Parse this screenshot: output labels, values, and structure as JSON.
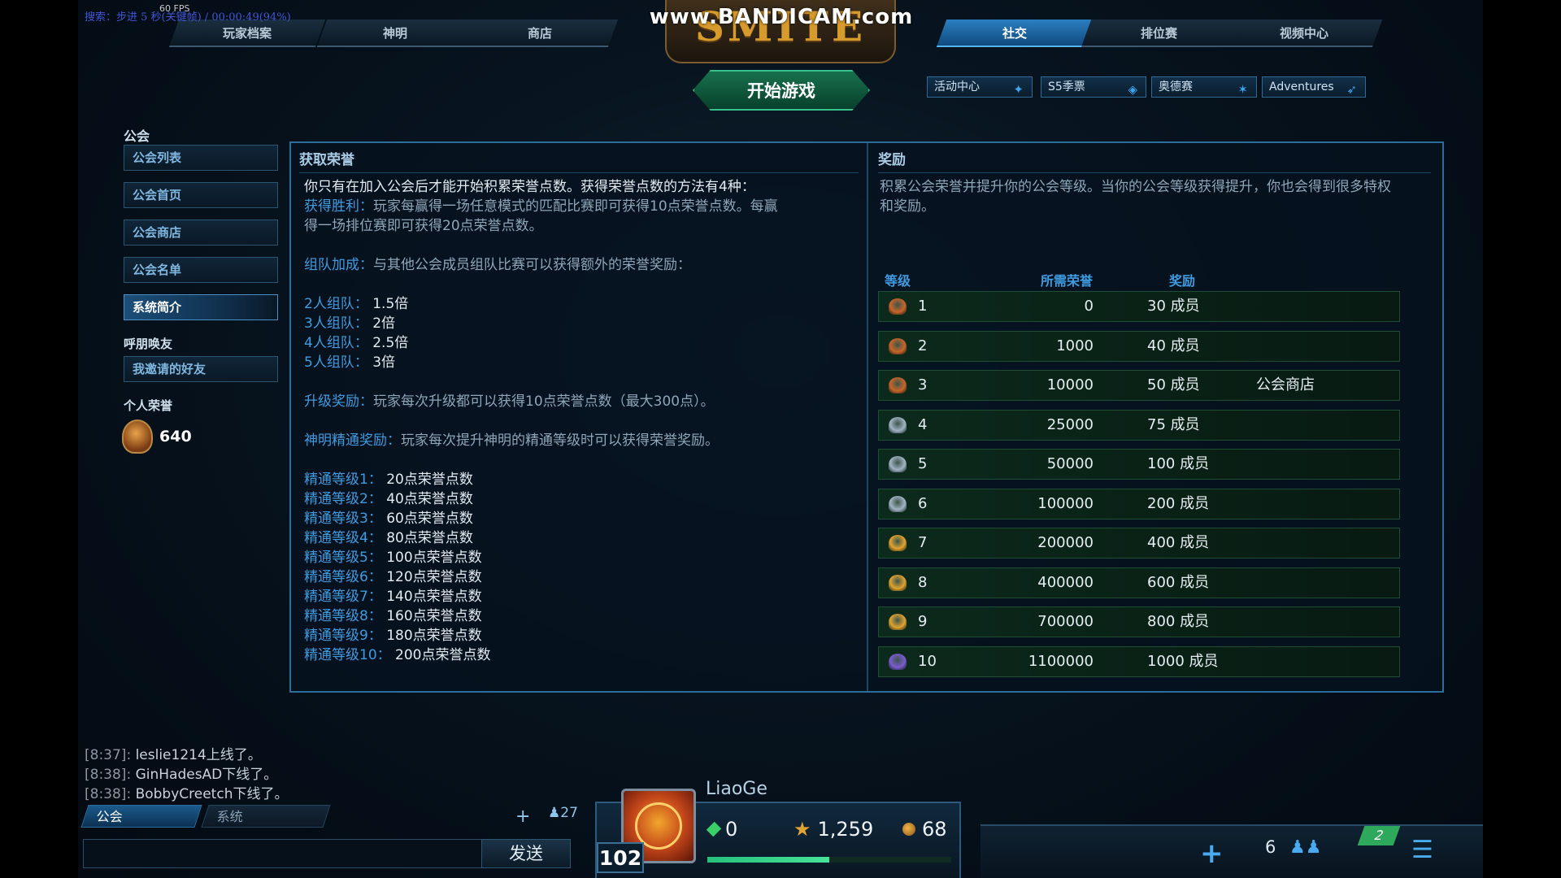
{
  "recorder": {
    "status_text": "搜索：步进 5 秒(关键帧) / 00:00:49(94%)",
    "fps_text": "60 FPS",
    "watermark": "www.BANDICAM.com"
  },
  "window": {
    "close_label": "✕"
  },
  "logo_text": "SMITE",
  "top_tabs": [
    {
      "label": "玩家档案"
    },
    {
      "label": "神明"
    },
    {
      "label": "商店"
    },
    {
      "label": "社交"
    },
    {
      "label": "排位赛"
    },
    {
      "label": "视频中心"
    }
  ],
  "active_top_tab": "社交",
  "play_button": "开始游戏",
  "sub_tabs": [
    {
      "label": "活动中心",
      "icon": "event-icon"
    },
    {
      "label": "S5季票",
      "icon": "season-pass-icon"
    },
    {
      "label": "奥德赛",
      "icon": "odyssey-icon"
    },
    {
      "label": "Adventures",
      "icon": "adventure-icon"
    }
  ],
  "sidebar": {
    "guild_heading": "公会",
    "guild_items": [
      {
        "label": "公会列表"
      },
      {
        "label": "公会首页"
      },
      {
        "label": "公会商店"
      },
      {
        "label": "公会名单"
      },
      {
        "label": "系统简介"
      }
    ],
    "active_item": "系统简介",
    "friends_heading": "呼朋唤友",
    "friends_items": [
      {
        "label": "我邀请的好友"
      }
    ],
    "honor_heading": "个人荣誉",
    "honor_value": "640"
  },
  "earn_section": {
    "title": "获取荣誉",
    "intro": "你只有在加入公会后才能开始积累荣誉点数。获得荣誉点数的方法有4种：",
    "win_label": "获得胜利：",
    "win_text_1": "玩家每赢得一场任意模式的匹配比赛即可获得10点荣誉点数。每赢",
    "win_text_2": "得一场排位赛即可获得20点荣誉点数。",
    "party_label": "组队加成：",
    "party_text": "与其他公会成员组队比赛可以获得额外的荣誉奖励：",
    "party_bonuses": [
      {
        "label": "2人组队：",
        "value": "1.5倍"
      },
      {
        "label": "3人组队：",
        "value": "2倍"
      },
      {
        "label": "4人组队：",
        "value": "2.5倍"
      },
      {
        "label": "5人组队：",
        "value": "3倍"
      }
    ],
    "levelup_label": "升级奖励：",
    "levelup_text": "玩家每次升级都可以获得10点荣誉点数（最大300点）。",
    "mastery_label": "神明精通奖励：",
    "mastery_text": "玩家每次提升神明的精通等级时可以获得荣誉奖励。",
    "mastery_levels": [
      {
        "label": "精通等级1：",
        "value": "20点荣誉点数"
      },
      {
        "label": "精通等级2：",
        "value": "40点荣誉点数"
      },
      {
        "label": "精通等级3：",
        "value": "60点荣誉点数"
      },
      {
        "label": "精通等级4：",
        "value": "80点荣誉点数"
      },
      {
        "label": "精通等级5：",
        "value": "100点荣誉点数"
      },
      {
        "label": "精通等级6：",
        "value": "120点荣誉点数"
      },
      {
        "label": "精通等级7：",
        "value": "140点荣誉点数"
      },
      {
        "label": "精通等级8：",
        "value": "160点荣誉点数"
      },
      {
        "label": "精通等级9：",
        "value": "180点荣誉点数"
      },
      {
        "label": "精通等级10：",
        "value": "200点荣誉点数"
      }
    ]
  },
  "reward_section": {
    "title": "奖励",
    "intro": "积累公会荣誉并提升你的公会等级。当你的公会等级获得提升，你也会得到很多特权和奖励。",
    "headers": {
      "level": "等级",
      "required": "所需荣誉",
      "reward": "奖励"
    },
    "rows": [
      {
        "level": "1",
        "required": "0",
        "reward": "30 成员",
        "extra": "",
        "icon_color": "#c9652a"
      },
      {
        "level": "2",
        "required": "1000",
        "reward": "40 成员",
        "extra": "",
        "icon_color": "#c9652a"
      },
      {
        "level": "3",
        "required": "10000",
        "reward": "50 成员",
        "extra": "公会商店",
        "icon_color": "#c9652a"
      },
      {
        "level": "4",
        "required": "25000",
        "reward": "75 成员",
        "extra": "",
        "icon_color": "#9fb3c4"
      },
      {
        "level": "5",
        "required": "50000",
        "reward": "100 成员",
        "extra": "",
        "icon_color": "#9fb3c4"
      },
      {
        "level": "6",
        "required": "100000",
        "reward": "200 成员",
        "extra": "",
        "icon_color": "#9fb3c4"
      },
      {
        "level": "7",
        "required": "200000",
        "reward": "400 成员",
        "extra": "",
        "icon_color": "#e0a22e"
      },
      {
        "level": "8",
        "required": "400000",
        "reward": "600 成员",
        "extra": "",
        "icon_color": "#e0a22e"
      },
      {
        "level": "9",
        "required": "700000",
        "reward": "800 成员",
        "extra": "",
        "icon_color": "#e0a22e"
      },
      {
        "level": "10",
        "required": "1100000",
        "reward": "1000 成员",
        "extra": "",
        "icon_color": "#7a5bd0"
      }
    ]
  },
  "chat": {
    "messages": [
      {
        "time": "[8:37]:",
        "text": " leslie1214上线了。"
      },
      {
        "time": "[8:38]:",
        "text": " GinHadesAD下线了。"
      },
      {
        "time": "[8:38]:",
        "text": " BobbyCreetch下线了。"
      }
    ],
    "tabs": [
      {
        "label": "公会"
      },
      {
        "label": "系统"
      }
    ],
    "send_label": "发送",
    "friends_online": "27"
  },
  "player": {
    "name": "LiaoGe",
    "level": "102",
    "gems": "0",
    "favor": "1,259",
    "worshippers": "68",
    "xp_fraction": 0.5
  },
  "bottom_right": {
    "friends_count": "6",
    "notification_badge": "2"
  }
}
